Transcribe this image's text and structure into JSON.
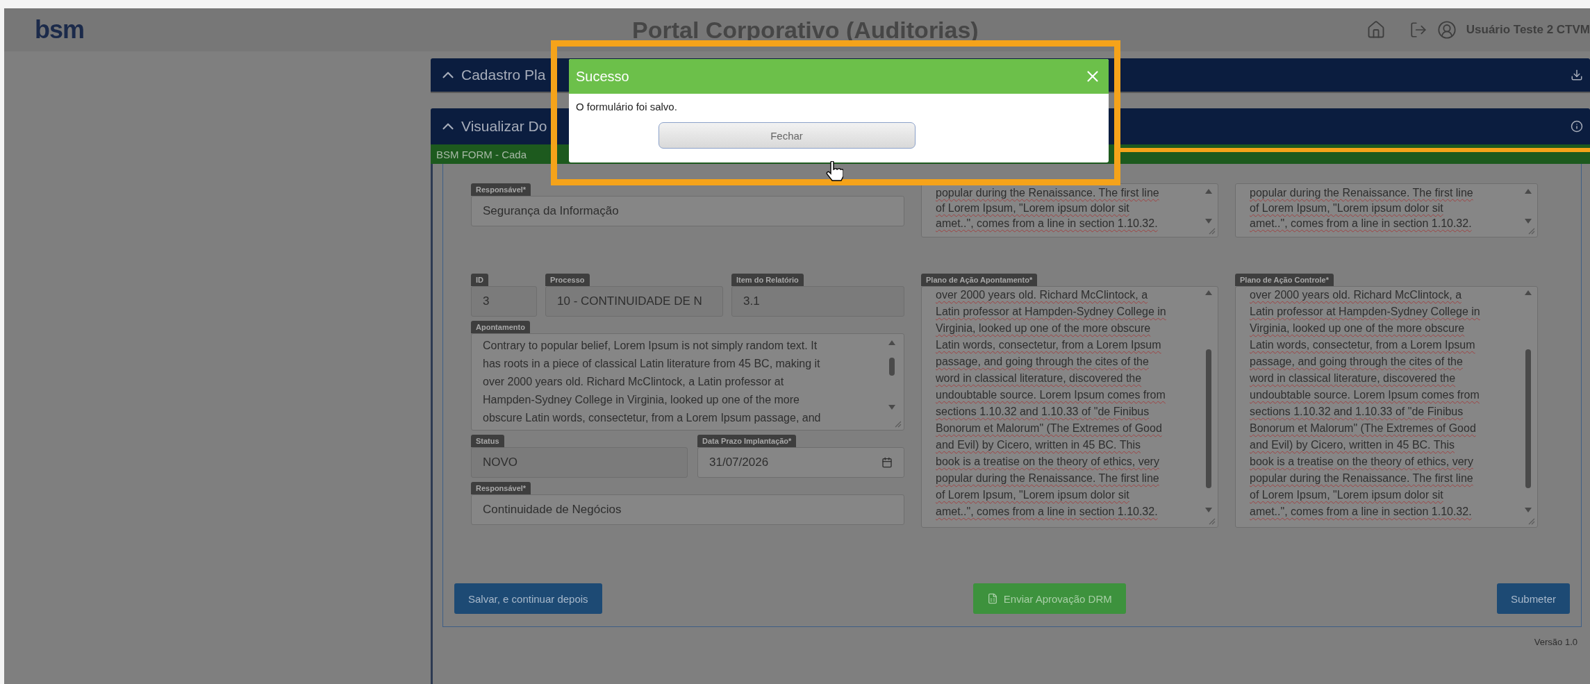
{
  "header": {
    "logo": "bsm",
    "title": "Portal Corporativo (Auditorias)",
    "user": "Usuário Teste 2 CTVM"
  },
  "panels": [
    {
      "title": "Cadastro Pla",
      "expanded": true,
      "kind": "download"
    },
    {
      "title": "Visualizar Do",
      "expanded": true,
      "kind": "info"
    }
  ],
  "form_bar": "BSM FORM - Cada",
  "top_section": {
    "responsible": {
      "label": "Responsável*",
      "value": "Segurança da Informação"
    },
    "textareas": [
      {
        "lines": [
          "popular during the Renaissance. The first line",
          "of Lorem Ipsum, \"Lorem ipsum dolor sit",
          "amet..\", comes from a line in section 1.10.32."
        ]
      },
      {
        "lines": [
          "popular during the Renaissance. The first line",
          "of Lorem Ipsum, \"Lorem ipsum dolor sit",
          "amet..\", comes from a line in section 1.10.32."
        ]
      }
    ]
  },
  "item": {
    "id": {
      "label": "ID",
      "value": "3"
    },
    "process": {
      "label": "Processo",
      "value": "10 - CONTINUIDADE DE N"
    },
    "report_item": {
      "label": "Item do Relatório",
      "value": "3.1"
    },
    "finding": {
      "label": "Apontamento",
      "lines": [
        "Contrary to popular belief, Lorem Ipsum is not simply random text. It",
        "has roots in a piece of classical Latin literature from 45 BC, making it",
        "over 2000 years old. Richard McClintock, a Latin professor at",
        "Hampden-Sydney College in Virginia, looked up one of the more",
        "obscure Latin words, consectetur, from a Lorem Ipsum passage, and"
      ]
    },
    "status": {
      "label": "Status",
      "value": "NOVO"
    },
    "deadline": {
      "label": "Data Prazo Implantação*",
      "value": "31/07/2026"
    },
    "responsible": {
      "label": "Responsável*",
      "value": "Continuidade de Negócios"
    },
    "plans": [
      {
        "label": "Plano de Ação Apontamento*",
        "lines": [
          "over 2000 years old. Richard McClintock, a",
          "Latin professor at Hampden-Sydney College in",
          "Virginia, looked up one of the more obscure",
          "Latin words, consectetur, from a Lorem Ipsum",
          "passage, and going through the cites of the",
          "word in classical literature, discovered the",
          "undoubtable source. Lorem Ipsum comes from",
          "sections 1.10.32 and 1.10.33 of \"de Finibus",
          "Bonorum et Malorum\" (The Extremes of Good",
          "and Evil) by Cicero, written in 45 BC. This",
          "book is a treatise on the theory of ethics, very",
          "popular during the Renaissance. The first line",
          "of Lorem Ipsum, \"Lorem ipsum dolor sit",
          "amet..\", comes from a line in section 1.10.32."
        ]
      },
      {
        "label": "Plano de Ação Controle*",
        "lines": [
          "over 2000 years old. Richard McClintock, a",
          "Latin professor at Hampden-Sydney College in",
          "Virginia, looked up one of the more obscure",
          "Latin words, consectetur, from a Lorem Ipsum",
          "passage, and going through the cites of the",
          "word in classical literature, discovered the",
          "undoubtable source. Lorem Ipsum comes from",
          "sections 1.10.32 and 1.10.33 of \"de Finibus",
          "Bonorum et Malorum\" (The Extremes of Good",
          "and Evil) by Cicero, written in 45 BC. This",
          "book is a treatise on the theory of ethics, very",
          "popular during the Renaissance. The first line",
          "of Lorem Ipsum, \"Lorem ipsum dolor sit",
          "amet..\", comes from a line in section 1.10.32."
        ]
      }
    ]
  },
  "buttons": [
    {
      "label": "Salvar, e continuar depois",
      "kind": "primary"
    },
    {
      "label": "Enviar Aprovação DRM",
      "kind": "success"
    },
    {
      "label": "Submeter",
      "kind": "primary"
    }
  ],
  "version": "Versão 1.0",
  "dialog": {
    "title": "Sucesso",
    "message": "O formulário foi salvo.",
    "button": "Fechar"
  }
}
